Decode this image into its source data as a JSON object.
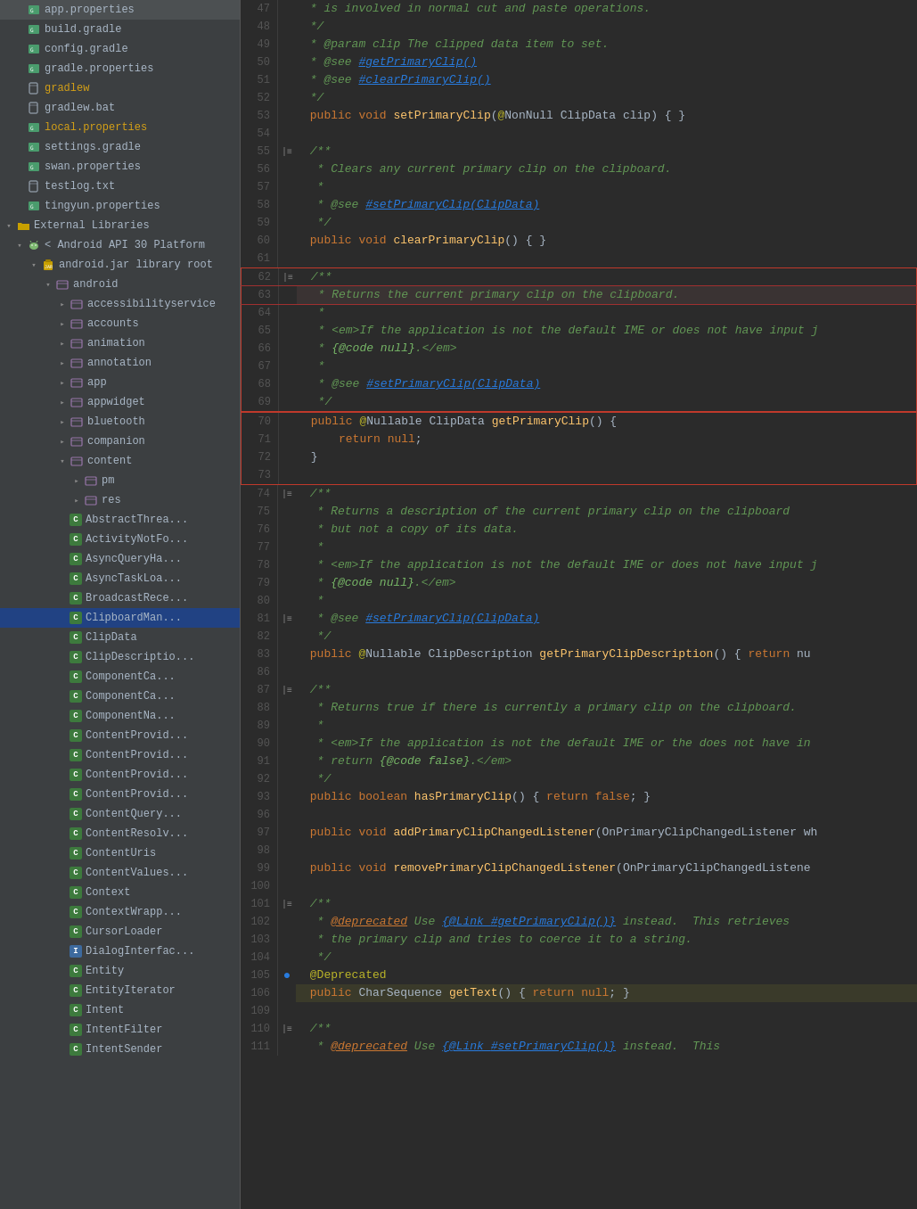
{
  "sidebar": {
    "items": [
      {
        "id": "app-properties",
        "label": "app.properties",
        "indent": 1,
        "icon": "gradle",
        "arrow": "empty"
      },
      {
        "id": "build-gradle",
        "label": "build.gradle",
        "indent": 1,
        "icon": "gradle",
        "arrow": "empty"
      },
      {
        "id": "config-gradle",
        "label": "config.gradle",
        "indent": 1,
        "icon": "gradle",
        "arrow": "empty"
      },
      {
        "id": "gradle-properties",
        "label": "gradle.properties",
        "indent": 1,
        "icon": "gradle",
        "arrow": "empty"
      },
      {
        "id": "gradlew",
        "label": "gradlew",
        "indent": 1,
        "icon": "file",
        "arrow": "empty",
        "color": "yellow"
      },
      {
        "id": "gradlew-bat",
        "label": "gradlew.bat",
        "indent": 1,
        "icon": "file",
        "arrow": "empty"
      },
      {
        "id": "local-properties",
        "label": "local.properties",
        "indent": 1,
        "icon": "gradle",
        "arrow": "empty",
        "color": "yellow"
      },
      {
        "id": "settings-gradle",
        "label": "settings.gradle",
        "indent": 1,
        "icon": "gradle",
        "arrow": "empty"
      },
      {
        "id": "swan-properties",
        "label": "swan.properties",
        "indent": 1,
        "icon": "gradle",
        "arrow": "empty"
      },
      {
        "id": "testlog-txt",
        "label": "testlog.txt",
        "indent": 1,
        "icon": "file",
        "arrow": "empty"
      },
      {
        "id": "tingyun-properties",
        "label": "tingyun.properties",
        "indent": 1,
        "icon": "gradle",
        "arrow": "empty"
      },
      {
        "id": "external-libraries",
        "label": "External Libraries",
        "indent": 0,
        "icon": "folder",
        "arrow": "open"
      },
      {
        "id": "android-api",
        "label": "< Android API 30 Platform",
        "indent": 1,
        "icon": "android",
        "arrow": "open"
      },
      {
        "id": "android-jar",
        "label": "android.jar  library root",
        "indent": 2,
        "icon": "jar",
        "arrow": "open"
      },
      {
        "id": "android-pkg",
        "label": "android",
        "indent": 3,
        "icon": "package",
        "arrow": "open"
      },
      {
        "id": "accessibilityservice",
        "label": "accessibilityservice",
        "indent": 4,
        "icon": "package",
        "arrow": "closed"
      },
      {
        "id": "accounts",
        "label": "accounts",
        "indent": 4,
        "icon": "package",
        "arrow": "closed"
      },
      {
        "id": "animation",
        "label": "animation",
        "indent": 4,
        "icon": "package",
        "arrow": "closed"
      },
      {
        "id": "annotation",
        "label": "annotation",
        "indent": 4,
        "icon": "package",
        "arrow": "closed"
      },
      {
        "id": "app",
        "label": "app",
        "indent": 4,
        "icon": "package",
        "arrow": "closed"
      },
      {
        "id": "appwidget",
        "label": "appwidget",
        "indent": 4,
        "icon": "package",
        "arrow": "closed"
      },
      {
        "id": "bluetooth",
        "label": "bluetooth",
        "indent": 4,
        "icon": "package",
        "arrow": "closed"
      },
      {
        "id": "companion",
        "label": "companion",
        "indent": 4,
        "icon": "package",
        "arrow": "closed"
      },
      {
        "id": "content",
        "label": "content",
        "indent": 4,
        "icon": "package",
        "arrow": "open"
      },
      {
        "id": "pm",
        "label": "pm",
        "indent": 5,
        "icon": "package",
        "arrow": "closed"
      },
      {
        "id": "res",
        "label": "res",
        "indent": 5,
        "icon": "package",
        "arrow": "closed"
      },
      {
        "id": "abstract-thread",
        "label": "AbstractThrea...",
        "indent": 4,
        "icon": "class",
        "arrow": "empty"
      },
      {
        "id": "activity-not-found",
        "label": "ActivityNotFo...",
        "indent": 4,
        "icon": "class",
        "arrow": "empty"
      },
      {
        "id": "async-query",
        "label": "AsyncQueryHa...",
        "indent": 4,
        "icon": "class",
        "arrow": "empty"
      },
      {
        "id": "async-task",
        "label": "AsyncTaskLoa...",
        "indent": 4,
        "icon": "class",
        "arrow": "empty"
      },
      {
        "id": "broadcast-recv",
        "label": "BroadcastRece...",
        "indent": 4,
        "icon": "class",
        "arrow": "empty"
      },
      {
        "id": "clipboard-man",
        "label": "ClipboardMan...",
        "indent": 4,
        "icon": "class",
        "arrow": "empty",
        "selected": true
      },
      {
        "id": "clip-data",
        "label": "ClipData",
        "indent": 4,
        "icon": "class",
        "arrow": "empty"
      },
      {
        "id": "clip-description",
        "label": "ClipDescriptio...",
        "indent": 4,
        "icon": "class",
        "arrow": "empty"
      },
      {
        "id": "component-ca1",
        "label": "ComponentCa...",
        "indent": 4,
        "icon": "class",
        "arrow": "empty"
      },
      {
        "id": "component-ca2",
        "label": "ComponentCa...",
        "indent": 4,
        "icon": "class",
        "arrow": "empty"
      },
      {
        "id": "component-na",
        "label": "ComponentNa...",
        "indent": 4,
        "icon": "class",
        "arrow": "empty"
      },
      {
        "id": "content-provic1",
        "label": "ContentProvid...",
        "indent": 4,
        "icon": "class",
        "arrow": "empty"
      },
      {
        "id": "content-provic2",
        "label": "ContentProvid...",
        "indent": 4,
        "icon": "class",
        "arrow": "empty"
      },
      {
        "id": "content-provic3",
        "label": "ContentProvid...",
        "indent": 4,
        "icon": "class",
        "arrow": "empty"
      },
      {
        "id": "content-provic4",
        "label": "ContentProvid...",
        "indent": 4,
        "icon": "class",
        "arrow": "empty"
      },
      {
        "id": "content-query",
        "label": "ContentQuery...",
        "indent": 4,
        "icon": "class",
        "arrow": "empty"
      },
      {
        "id": "content-resolv",
        "label": "ContentResolv...",
        "indent": 4,
        "icon": "class",
        "arrow": "empty"
      },
      {
        "id": "content-uris",
        "label": "ContentUris",
        "indent": 4,
        "icon": "class",
        "arrow": "empty"
      },
      {
        "id": "content-values",
        "label": "ContentValues...",
        "indent": 4,
        "icon": "class",
        "arrow": "empty"
      },
      {
        "id": "context",
        "label": "Context",
        "indent": 4,
        "icon": "class",
        "arrow": "empty"
      },
      {
        "id": "context-wrapp",
        "label": "ContextWrapp...",
        "indent": 4,
        "icon": "class",
        "arrow": "empty"
      },
      {
        "id": "cursor-loader",
        "label": "CursorLoader",
        "indent": 4,
        "icon": "class",
        "arrow": "empty"
      },
      {
        "id": "dialog-interface",
        "label": "DialogInterfac...",
        "indent": 4,
        "icon": "interface",
        "arrow": "empty"
      },
      {
        "id": "entity",
        "label": "Entity",
        "indent": 4,
        "icon": "class",
        "arrow": "empty"
      },
      {
        "id": "entity-iterator",
        "label": "EntityIterator",
        "indent": 4,
        "icon": "class",
        "arrow": "empty"
      },
      {
        "id": "intent",
        "label": "Intent",
        "indent": 4,
        "icon": "class",
        "arrow": "empty"
      },
      {
        "id": "intent-filter",
        "label": "IntentFilter",
        "indent": 4,
        "icon": "class",
        "arrow": "empty"
      },
      {
        "id": "intent-sender",
        "label": "IntentSender",
        "indent": 4,
        "icon": "class",
        "arrow": "empty"
      }
    ]
  },
  "editor": {
    "lines": [
      {
        "num": 47,
        "gutter": "",
        "content": " * is involved in normal cut and paste operations.",
        "type": "comment"
      },
      {
        "num": 48,
        "gutter": "",
        "content": " */",
        "type": "comment"
      },
      {
        "num": 49,
        "gutter": "",
        "content": " * @param clip The clipped data item to set.",
        "type": "comment"
      },
      {
        "num": 50,
        "gutter": "",
        "content": " * @see #getPrimaryClip()",
        "type": "comment-ref"
      },
      {
        "num": 51,
        "gutter": "",
        "content": " * @see #clearPrimaryClip()",
        "type": "comment-ref"
      },
      {
        "num": 52,
        "gutter": "",
        "content": " */",
        "type": "comment"
      },
      {
        "num": 53,
        "gutter": "",
        "content": " public void setPrimaryClip(@NonNull ClipData clip) { }",
        "type": "code"
      },
      {
        "num": 54,
        "gutter": "",
        "content": "",
        "type": "blank"
      },
      {
        "num": 55,
        "gutter": "|≡",
        "content": " /**",
        "type": "comment"
      },
      {
        "num": 56,
        "gutter": "",
        "content": "  * Clears any current primary clip on the clipboard.",
        "type": "comment"
      },
      {
        "num": 57,
        "gutter": "",
        "content": "  *",
        "type": "comment"
      },
      {
        "num": 58,
        "gutter": "",
        "content": "  * @see #setPrimaryClip(ClipData)",
        "type": "comment-ref"
      },
      {
        "num": 59,
        "gutter": "",
        "content": "  */",
        "type": "comment"
      },
      {
        "num": 60,
        "gutter": "",
        "content": " public void clearPrimaryClip() { }",
        "type": "code"
      },
      {
        "num": 61,
        "gutter": "",
        "content": "",
        "type": "blank"
      },
      {
        "num": 62,
        "gutter": "|≡",
        "content": " /**",
        "type": "comment",
        "box_start": true
      },
      {
        "num": 63,
        "gutter": "",
        "content": "  * Returns the current primary clip on the clipboard.",
        "type": "comment-highlight",
        "box_mid": true
      },
      {
        "num": 64,
        "gutter": "",
        "content": "  *",
        "type": "comment",
        "box_mid": true
      },
      {
        "num": 65,
        "gutter": "",
        "content": "  * <em>If the application is not the default IME or does not have input j",
        "type": "comment",
        "box_mid": true
      },
      {
        "num": 66,
        "gutter": "",
        "content": "  * {@code null}.</em>",
        "type": "comment",
        "box_mid": true
      },
      {
        "num": 67,
        "gutter": "",
        "content": "  *",
        "type": "comment",
        "box_mid": true
      },
      {
        "num": 68,
        "gutter": "",
        "content": "  * @see #setPrimaryClip(ClipData)",
        "type": "comment-ref",
        "box_mid": true
      },
      {
        "num": 69,
        "gutter": "",
        "content": "  */",
        "type": "comment",
        "box_end": true
      },
      {
        "num": 70,
        "gutter": "",
        "content": " public @Nullable ClipData getPrimaryClip() {",
        "type": "code",
        "box2_start": true
      },
      {
        "num": 71,
        "gutter": "",
        "content": "     return null;",
        "type": "code",
        "box2_mid": true
      },
      {
        "num": 72,
        "gutter": "",
        "content": " }",
        "type": "code",
        "box2_mid": true
      },
      {
        "num": 73,
        "gutter": "",
        "content": "",
        "type": "blank",
        "box2_end": true
      },
      {
        "num": 74,
        "gutter": "|≡",
        "content": " /**",
        "type": "comment"
      },
      {
        "num": 75,
        "gutter": "",
        "content": "  * Returns a description of the current primary clip on the clipboard",
        "type": "comment"
      },
      {
        "num": 76,
        "gutter": "",
        "content": "  * but not a copy of its data.",
        "type": "comment"
      },
      {
        "num": 77,
        "gutter": "",
        "content": "  *",
        "type": "comment"
      },
      {
        "num": 78,
        "gutter": "",
        "content": "  * <em>If the application is not the default IME or does not have input j",
        "type": "comment"
      },
      {
        "num": 79,
        "gutter": "",
        "content": "  * {@code null}.</em>",
        "type": "comment"
      },
      {
        "num": 80,
        "gutter": "",
        "content": "  *",
        "type": "comment"
      },
      {
        "num": 81,
        "gutter": "|≡",
        "content": "  * @see #setPrimaryClip(ClipData)",
        "type": "comment-ref"
      },
      {
        "num": 82,
        "gutter": "",
        "content": "  */",
        "type": "comment"
      },
      {
        "num": 83,
        "gutter": "",
        "content": " public @Nullable ClipDescription getPrimaryClipDescription() { return nu",
        "type": "code"
      },
      {
        "num": 86,
        "gutter": "",
        "content": "",
        "type": "blank"
      },
      {
        "num": 87,
        "gutter": "|≡",
        "content": " /**",
        "type": "comment"
      },
      {
        "num": 88,
        "gutter": "",
        "content": "  * Returns true if there is currently a primary clip on the clipboard.",
        "type": "comment"
      },
      {
        "num": 89,
        "gutter": "",
        "content": "  *",
        "type": "comment"
      },
      {
        "num": 90,
        "gutter": "",
        "content": "  * <em>If the application is not the default IME or the does not have in",
        "type": "comment"
      },
      {
        "num": 91,
        "gutter": "",
        "content": "  * return {@code false}.</em>",
        "type": "comment"
      },
      {
        "num": 92,
        "gutter": "",
        "content": "  */",
        "type": "comment"
      },
      {
        "num": 93,
        "gutter": "",
        "content": " public boolean hasPrimaryClip() { return false; }",
        "type": "code"
      },
      {
        "num": 96,
        "gutter": "",
        "content": "",
        "type": "blank"
      },
      {
        "num": 97,
        "gutter": "",
        "content": " public void addPrimaryClipChangedListener(OnPrimaryClipChangedListener wh",
        "type": "code"
      },
      {
        "num": 98,
        "gutter": "",
        "content": "",
        "type": "blank"
      },
      {
        "num": 99,
        "gutter": "",
        "content": " public void removePrimaryClipChangedListener(OnPrimaryClipChangedListene",
        "type": "code"
      },
      {
        "num": 100,
        "gutter": "",
        "content": "",
        "type": "blank"
      },
      {
        "num": 101,
        "gutter": "|≡",
        "content": " /**",
        "type": "comment"
      },
      {
        "num": 102,
        "gutter": "",
        "content": "  * @deprecated Use {@Link #getPrimaryClip()} instead.  This retrieves",
        "type": "comment-deprecated"
      },
      {
        "num": 103,
        "gutter": "",
        "content": "  * the primary clip and tries to coerce it to a string.",
        "type": "comment"
      },
      {
        "num": 104,
        "gutter": "",
        "content": "  */",
        "type": "comment"
      },
      {
        "num": 105,
        "gutter": "●",
        "content": " @Deprecated",
        "type": "annotation"
      },
      {
        "num": 106,
        "gutter": "",
        "content": " public CharSequence getText() { return null; }",
        "type": "code-highlight"
      },
      {
        "num": 109,
        "gutter": "",
        "content": "",
        "type": "blank"
      },
      {
        "num": 110,
        "gutter": "|≡",
        "content": " /**",
        "type": "comment"
      },
      {
        "num": 111,
        "gutter": "",
        "content": "  * @deprecated Use {@Link #setPrimaryClip()} instead.  This",
        "type": "comment-deprecated"
      }
    ]
  }
}
